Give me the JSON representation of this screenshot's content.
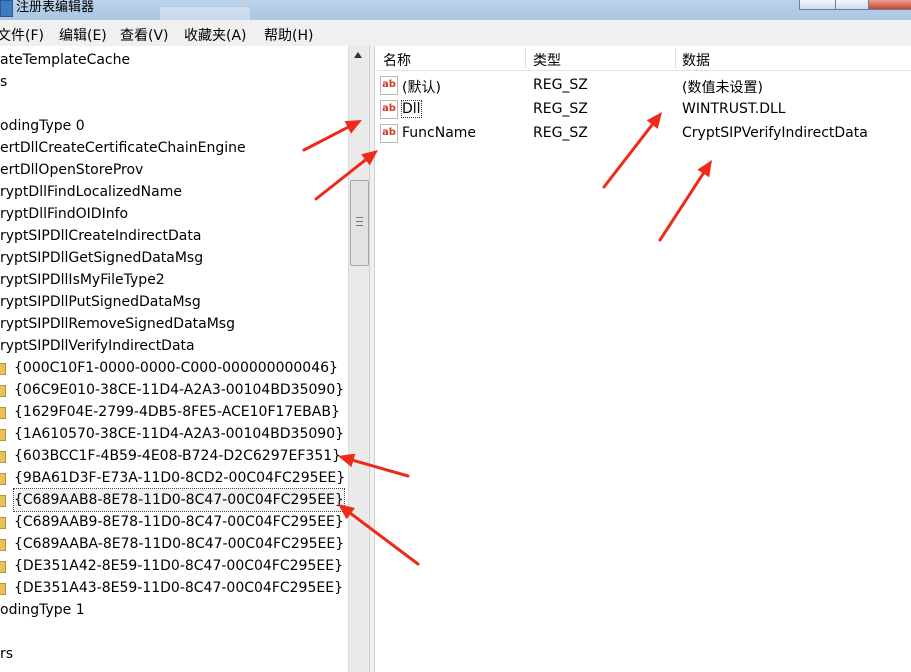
{
  "window": {
    "title": "注册表编辑器"
  },
  "menu": [
    "文件(F)",
    "编辑(E)",
    "查看(V)",
    "收藏夹(A)",
    "帮助(H)"
  ],
  "tree": {
    "items": [
      {
        "label": "ateTemplateCache",
        "kind": "key"
      },
      {
        "label": "s",
        "kind": "key"
      },
      {
        "label": "",
        "kind": "key"
      },
      {
        "label": "odingType 0",
        "kind": "key"
      },
      {
        "label": "ertDllCreateCertificateChainEngine",
        "kind": "key"
      },
      {
        "label": "ertDllOpenStoreProv",
        "kind": "key"
      },
      {
        "label": "ryptDllFindLocalizedName",
        "kind": "key"
      },
      {
        "label": "ryptDllFindOIDInfo",
        "kind": "key"
      },
      {
        "label": "ryptSIPDllCreateIndirectData",
        "kind": "key"
      },
      {
        "label": "ryptSIPDllGetSignedDataMsg",
        "kind": "key"
      },
      {
        "label": "ryptSIPDllIsMyFileType2",
        "kind": "key"
      },
      {
        "label": "ryptSIPDllPutSignedDataMsg",
        "kind": "key"
      },
      {
        "label": "ryptSIPDllRemoveSignedDataMsg",
        "kind": "key"
      },
      {
        "label": "ryptSIPDllVerifyIndirectData",
        "kind": "key"
      },
      {
        "label": "{000C10F1-0000-0000-C000-000000000046}",
        "kind": "guid"
      },
      {
        "label": "{06C9E010-38CE-11D4-A2A3-00104BD35090}",
        "kind": "guid"
      },
      {
        "label": "{1629F04E-2799-4DB5-8FE5-ACE10F17EBAB}",
        "kind": "guid"
      },
      {
        "label": "{1A610570-38CE-11D4-A2A3-00104BD35090}",
        "kind": "guid"
      },
      {
        "label": "{603BCC1F-4B59-4E08-B724-D2C6297EF351}",
        "kind": "guid"
      },
      {
        "label": "{9BA61D3F-E73A-11D0-8CD2-00C04FC295EE}",
        "kind": "guid"
      },
      {
        "label": "{C689AAB8-8E78-11D0-8C47-00C04FC295EE}",
        "kind": "guid",
        "selected": true
      },
      {
        "label": "{C689AAB9-8E78-11D0-8C47-00C04FC295EE}",
        "kind": "guid"
      },
      {
        "label": "{C689AABA-8E78-11D0-8C47-00C04FC295EE}",
        "kind": "guid"
      },
      {
        "label": "{DE351A42-8E59-11D0-8C47-00C04FC295EE}",
        "kind": "guid"
      },
      {
        "label": "{DE351A43-8E59-11D0-8C47-00C04FC295EE}",
        "kind": "guid"
      },
      {
        "label": "odingType 1",
        "kind": "key"
      },
      {
        "label": "",
        "kind": "key"
      },
      {
        "label": "rs",
        "kind": "key"
      }
    ]
  },
  "list": {
    "headers": {
      "name": "名称",
      "type": "类型",
      "data": "数据"
    },
    "rows": [
      {
        "icon": "ab",
        "name": "(默认)",
        "type": "REG_SZ",
        "data": "(数值未设置)"
      },
      {
        "icon": "ab",
        "name": "Dll",
        "type": "REG_SZ",
        "data": "WINTRUST.DLL"
      },
      {
        "icon": "ab",
        "name": "FuncName",
        "type": "REG_SZ",
        "data": "CryptSIPVerifyIndirectData"
      }
    ]
  },
  "annotation_color": "#ee2a1a"
}
